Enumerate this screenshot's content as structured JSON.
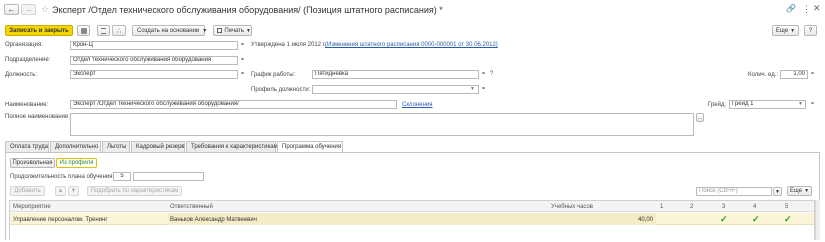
{
  "header": {
    "title": "Эксперт /Отдел технического обслуживания оборудования/ (Позиция штатного расписания) *"
  },
  "toolbar": {
    "save_close": "Записать и закрыть",
    "create_based": "Создать на основании",
    "print": "Печать",
    "more": "Еще",
    "help": "?"
  },
  "form": {
    "org_label": "Организация:",
    "org_value": "Крон-Ц",
    "approved_text": "Утверждена 1 июля 2012 г.",
    "approved_link": "(Изменения штатного расписания 0000-000001 от 30.06.2012)",
    "dept_label": "Подразделение:",
    "dept_value": "Отдел технического обслуживания оборудования",
    "position_label": "Должность:",
    "position_value": "Эксперт",
    "schedule_label": "График работы:",
    "schedule_value": "Пятидневка",
    "count_label": "Колич. ед.:",
    "count_value": "1,00",
    "profile_label": "Профиль должности:",
    "profile_value": "",
    "name_label": "Наименование:",
    "name_value": "Эксперт /Отдел технического обслуживания оборудования/",
    "declension_link": "Склонения",
    "grade_label": "Грейд:",
    "grade_value": "Грейд 1",
    "fullname_label": "Полное наименование:",
    "fullname_value": "",
    "help_q": "?"
  },
  "tabs": [
    {
      "label": "Оплата труда"
    },
    {
      "label": "Дополнительно"
    },
    {
      "label": "Льготы"
    },
    {
      "label": "Кадровый резерв"
    },
    {
      "label": "Требования к характеристикам"
    },
    {
      "label": "Программа обучения"
    }
  ],
  "training": {
    "toggle_arbitrary": "Произвольная",
    "toggle_profile": "Из профиля",
    "duration_label": "Продолжительность плана обучения:",
    "duration_value": "5",
    "add_button": "Добавить",
    "select_button": "Подобрать по характеристикам",
    "search_placeholder": "Поиск (Ctrl+F)",
    "more": "Еще",
    "columns": {
      "event": "Мероприятие",
      "responsible": "Ответственный",
      "hours": "Учебных часов",
      "c1": "1",
      "c2": "2",
      "c3": "3",
      "c4": "4",
      "c5": "5"
    },
    "row": {
      "event": "Управление персоналом. Тренинг",
      "responsible": "Ваньков Александр Матвеевич",
      "hours": "40,00"
    }
  },
  "colors": {
    "accent_yellow": "#f6d500",
    "row_highlight": "#fbf5d8",
    "check_green": "#2c9b2c",
    "link_blue": "#2a5cad"
  }
}
